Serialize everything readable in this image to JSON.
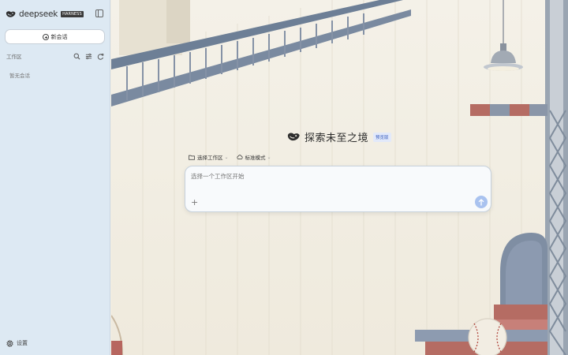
{
  "brand": {
    "name": "deepseek",
    "badge": "HARNESS"
  },
  "sidebar": {
    "new_chat_label": "新会话",
    "workspace_label": "工作区",
    "empty_text": "暂无会话",
    "settings_label": "设置"
  },
  "main": {
    "title": "探索未至之境",
    "badge": "预览版",
    "options": {
      "workspace": "选择工作区",
      "mode": "标准模式"
    },
    "input_placeholder": "选择一个工作区开始"
  },
  "icons": [
    "whale-logo-icon",
    "sidebar-toggle-icon",
    "plus-circle-icon",
    "search-icon",
    "filter-icon",
    "refresh-icon",
    "gear-icon",
    "folder-icon",
    "mode-icon",
    "chevron-down-icon",
    "plus-icon",
    "arrow-up-icon"
  ],
  "colors": {
    "sidebar_bg": "#dde9f3",
    "send_button": "#a9c2ef",
    "badge_text": "#3b5fbf"
  }
}
